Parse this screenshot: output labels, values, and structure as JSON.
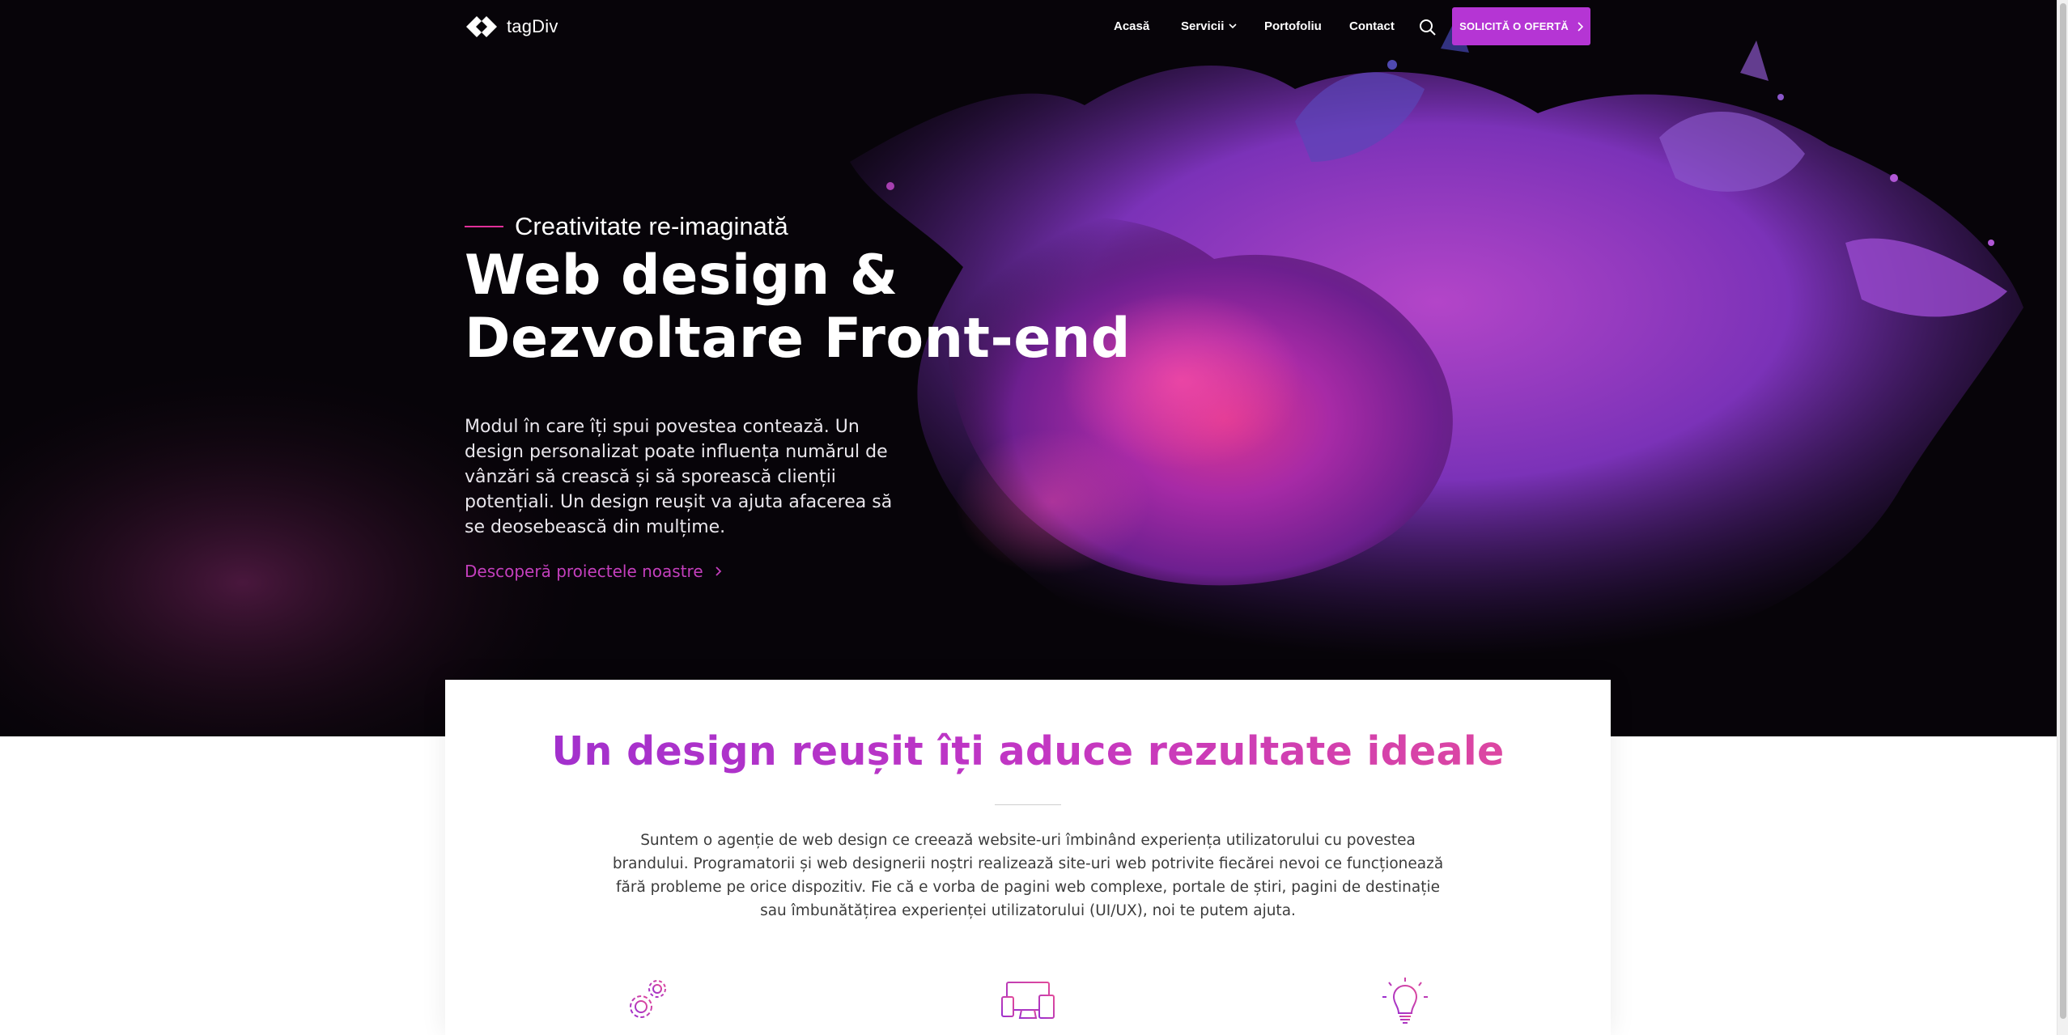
{
  "header": {
    "logo_text": "tagDiv",
    "nav": [
      "Acasă",
      "Servicii",
      "Portofoliu",
      "Contact"
    ],
    "cta_label": "SOLICITĂ O OFERTĂ"
  },
  "hero": {
    "tagline": "Creativitate re-imaginată",
    "title_line1": "Web design &",
    "title_line2": "Dezvoltare Front-end",
    "description": "Modul în care îți spui povestea contează. Un design personalizat poate influența numărul de vânzări să crească și să sporească clienții potențiali. Un design reușit va ajuta afacerea să se deosebească din mulțime.",
    "link_label": "Descoperă proiectele noastre"
  },
  "intro": {
    "title": "Un design reușit îți aduce rezultate ideale",
    "text": "Suntem o agenție de web design ce creează website-uri îmbinând experiența utilizatorului cu povestea brandului. Programatorii și web designerii noștri realizează site-uri web potrivite fiecărei nevoi ce funcționează fără probleme pe orice dispozitiv. Fie că e vorba de pagini web complexe, portale de știri, pagini de destinație sau îmbunătățirea experienței utilizatorului (UI/UX), noi te putem ajuta."
  },
  "colors": {
    "accent": "#b535d4",
    "hero_background": "#070409",
    "link": "#c43fbd",
    "tagline_line": "#e0309a"
  },
  "icons": [
    "logo-icon",
    "chevron-down-icon",
    "search-icon",
    "chevron-right-icon",
    "gears-icon",
    "devices-icon",
    "lightbulb-icon"
  ]
}
